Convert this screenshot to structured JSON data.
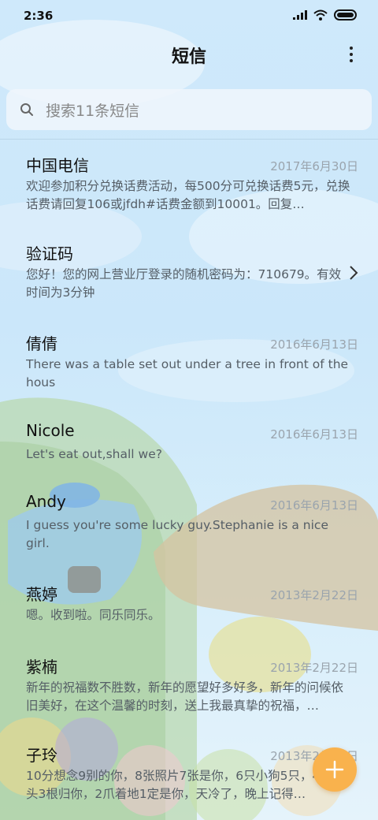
{
  "status_bar": {
    "time": "2:36"
  },
  "header": {
    "title": "短信"
  },
  "search": {
    "placeholder": "搜索11条短信"
  },
  "conversations": [
    {
      "name": "中国电信",
      "date": "2017年6月30日",
      "preview": "欢迎参加积分兑换话费活动，每500分可兑换话费5元，兑换话费请回复106或jfdh#话费金额到10001。回复…"
    },
    {
      "name": "验证码",
      "date": "",
      "preview": "您好！您的网上营业厅登录的随机密码为：710679。有效时间为3分钟"
    },
    {
      "name": "倩倩",
      "date": "2016年6月13日",
      "preview": "There was a table set out under a tree in front of the hous"
    },
    {
      "name": "Nicole",
      "date": "2016年6月13日",
      "preview": "Let's eat out,shall we?"
    },
    {
      "name": "Andy",
      "date": "2016年6月13日",
      "preview": "I guess you're some lucky guy.Stephanie is a nice girl."
    },
    {
      "name": "燕婷",
      "date": "2013年2月22日",
      "preview": "嗯。收到啦。同乐同乐。"
    },
    {
      "name": "紫楠",
      "date": "2013年2月22日",
      "preview": "新年的祝福数不胜数，新年的愿望好多好多，新年的问候依旧美好，在这个温馨的时刻，送上我最真挚的祝福，…"
    },
    {
      "name": "子玲",
      "date": "2013年2月22日",
      "preview": "10分想念9别的你，8张照片7张是你，6只小狗5只，4根骨头3根归你，2爪着地1定是你，天冷了，晚上记得…"
    }
  ],
  "icons": {
    "search": "search-icon",
    "more": "more-vertical-icon",
    "chevron": "chevron-right-icon",
    "compose": "plus-icon"
  },
  "colors": {
    "fab": "#f9b24d",
    "date": "#9aa4ad"
  }
}
